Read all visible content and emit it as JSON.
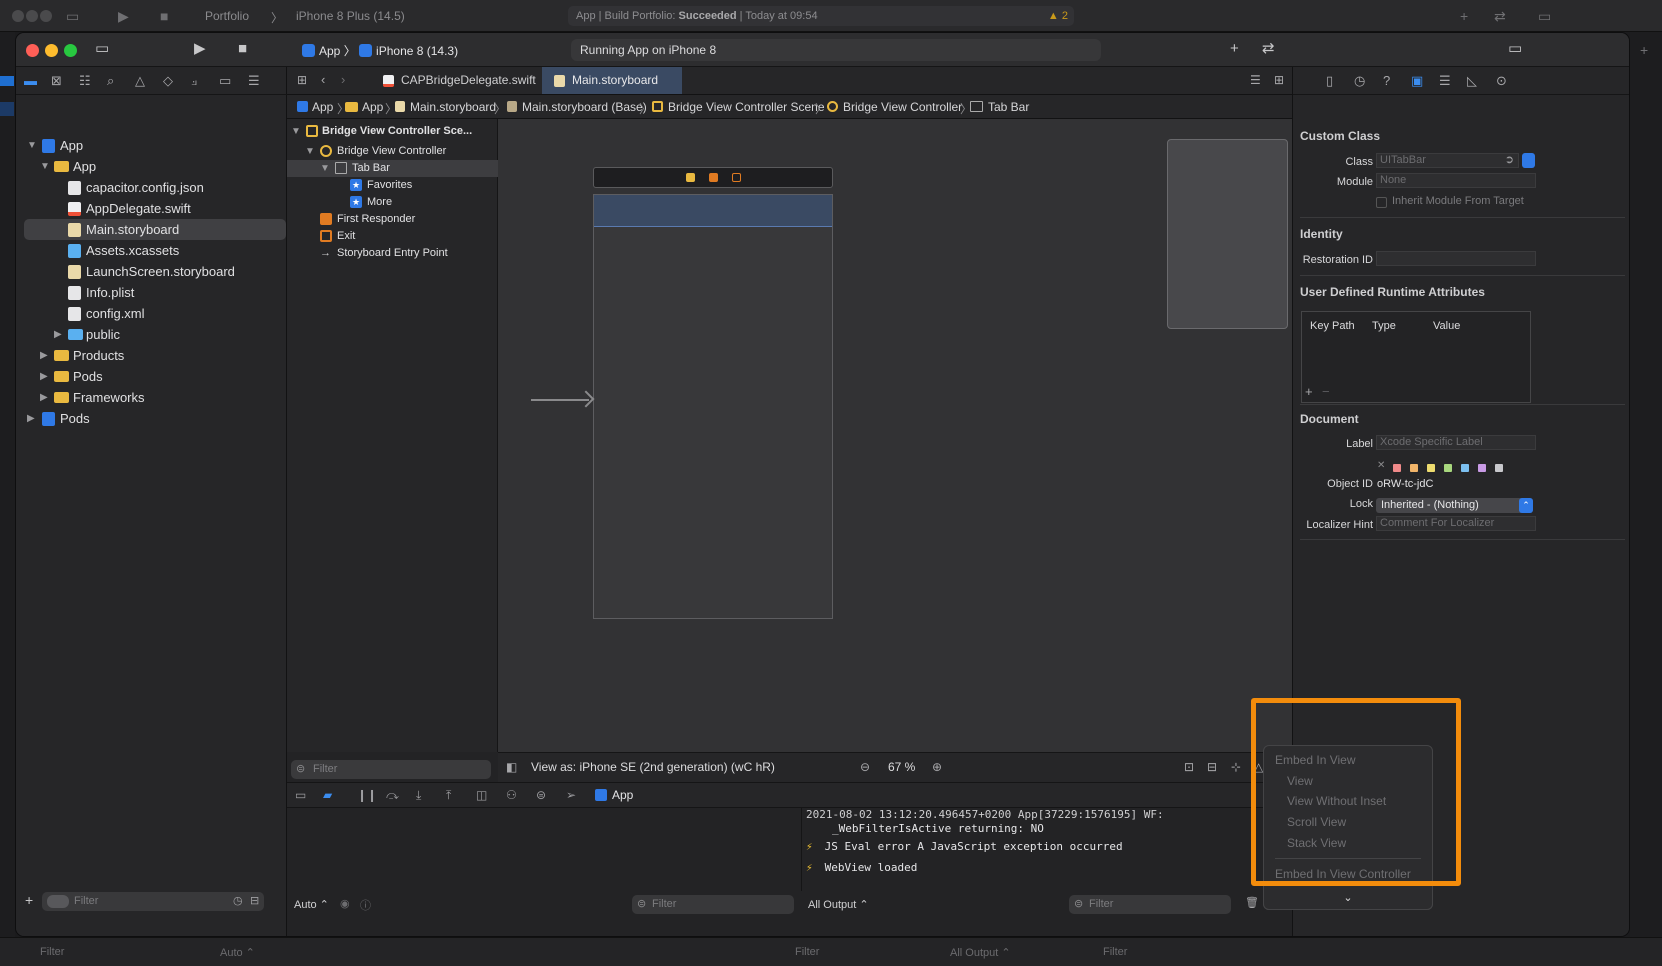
{
  "background_window": {
    "project": "Portfolio",
    "device": "iPhone 8 Plus (14.5)",
    "status_prefix": "App | Build Portfolio: ",
    "status_result": "Succeeded",
    "status_suffix": " | Today at 09:54",
    "warning_count": "2",
    "footer_filter1": "Filter",
    "footer_auto": "Auto ⌃",
    "footer_filter2": "Filter",
    "footer_all_output": "All Output ⌃",
    "footer_filter3": "Filter"
  },
  "toolbar": {
    "scheme_app": "App",
    "scheme_device": "iPhone 8 (14.3)",
    "status": "Running App on iPhone 8",
    "add_icon": "+",
    "swap_icon": "⇄"
  },
  "navigator": {
    "items": [
      {
        "label": "App"
      },
      {
        "label": "App"
      },
      {
        "label": "capacitor.config.json"
      },
      {
        "label": "AppDelegate.swift"
      },
      {
        "label": "Main.storyboard"
      },
      {
        "label": "Assets.xcassets"
      },
      {
        "label": "LaunchScreen.storyboard"
      },
      {
        "label": "Info.plist"
      },
      {
        "label": "config.xml"
      },
      {
        "label": "public"
      },
      {
        "label": "Products"
      },
      {
        "label": "Pods"
      },
      {
        "label": "Frameworks"
      },
      {
        "label": "Pods"
      }
    ],
    "filter_placeholder": "Filter"
  },
  "tabs": [
    {
      "label": "CAPBridgeDelegate.swift"
    },
    {
      "label": "Main.storyboard"
    }
  ],
  "breadcrumb": [
    "App",
    "App",
    "Main.storyboard",
    "Main.storyboard (Base)",
    "Bridge View Controller Scene",
    "Bridge View Controller",
    "Tab Bar"
  ],
  "outline": {
    "items": [
      "Bridge View Controller Sce...",
      "Bridge View Controller",
      "Tab Bar",
      "Favorites",
      "More",
      "First Responder",
      "Exit",
      "Storyboard Entry Point"
    ],
    "filter_placeholder": "Filter"
  },
  "canvas_footer": {
    "view_as": "View as: iPhone SE (2nd generation) (wC hR)",
    "zoom": "67 %"
  },
  "debug": {
    "target": "App",
    "console_lines": [
      "2021-08-02 13:12:20.496457+0200 App[37229:1576195] WF:",
      "_WebFilterIsActive returning: NO",
      "JS Eval error A JavaScript exception occurred",
      "WebView loaded"
    ],
    "auto_label": "Auto ⌃",
    "filter1": "Filter",
    "all_output": "All Output ⌃",
    "filter2": "Filter"
  },
  "inspector": {
    "custom_class_title": "Custom Class",
    "class_label": "Class",
    "class_value": "UITabBar",
    "module_label": "Module",
    "module_value": "None",
    "inherit_label": "Inherit Module From Target",
    "identity_title": "Identity",
    "restoration_label": "Restoration ID",
    "udra_title": "User Defined Runtime Attributes",
    "col_key_path": "Key Path",
    "col_type": "Type",
    "col_value": "Value",
    "table_add": "+",
    "table_remove": "−",
    "document_title": "Document",
    "label_label": "Label",
    "label_placeholder": "Xcode Specific Label",
    "object_id_label": "Object ID",
    "object_id_value": "oRW-tc-jdC",
    "lock_label": "Lock",
    "lock_value": "Inherited - (Nothing)",
    "localizer_label": "Localizer Hint",
    "localizer_placeholder": "Comment For Localizer",
    "label_colors": [
      "#f08a8a",
      "#f2b56a",
      "#eedc6f",
      "#a8d77e",
      "#7cc0f0",
      "#c99be6",
      "#c8c8cc"
    ]
  },
  "embed_menu": {
    "items": [
      "Embed In View",
      "View",
      "View Without Inset",
      "Scroll View",
      "Stack View",
      "Embed In View Controller"
    ],
    "scroll_down": "⌄",
    "highlight_color": "#f38c0c"
  }
}
